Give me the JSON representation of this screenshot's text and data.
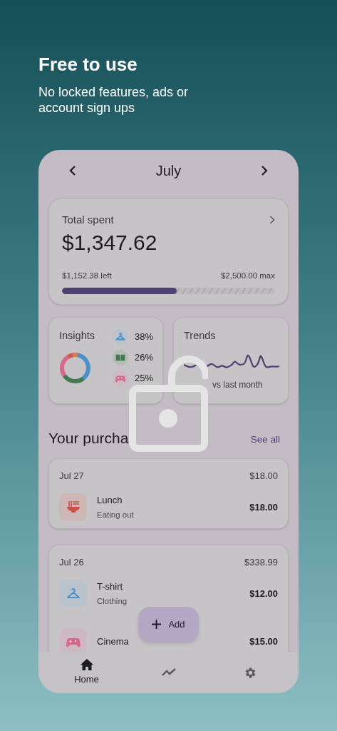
{
  "promo": {
    "title": "Free to use",
    "subtitle": "No locked features, ads or account sign ups"
  },
  "month": {
    "title": "July"
  },
  "total": {
    "label": "Total spent",
    "amount": "$1,347.62",
    "left": "$1,152.38 left",
    "max": "$2,500.00 max",
    "level": 0.54
  },
  "insights": {
    "title": "Insights",
    "items": [
      {
        "kind": "clothing",
        "percent": "38%",
        "color": "#4a90c8"
      },
      {
        "kind": "books",
        "percent": "26%",
        "color": "#3f7a52"
      },
      {
        "kind": "games",
        "percent": "25%",
        "color": "#d8678e"
      }
    ]
  },
  "trends": {
    "title": "Trends",
    "caption": "vs last month"
  },
  "purchases": {
    "title": "Your purcha",
    "see_all": "See all"
  },
  "groups": [
    {
      "date": "Jul 27",
      "total": "$18.00",
      "items": [
        {
          "kind": "food",
          "name": "Lunch",
          "category": "Eating out",
          "amount": "$18.00"
        }
      ]
    },
    {
      "date": "Jul 26",
      "total": "$338.99",
      "items": [
        {
          "kind": "clothing",
          "name": "T-shirt",
          "category": "Clothing",
          "amount": "$12.00"
        },
        {
          "kind": "games",
          "name": "Cinema",
          "amount": "$15.00"
        }
      ]
    }
  ],
  "fab": {
    "label": "Add"
  },
  "nav": [
    {
      "kind": "home",
      "label": "Home",
      "selected": true
    },
    {
      "kind": "trends",
      "selected": false
    },
    {
      "kind": "settings",
      "selected": false
    }
  ]
}
